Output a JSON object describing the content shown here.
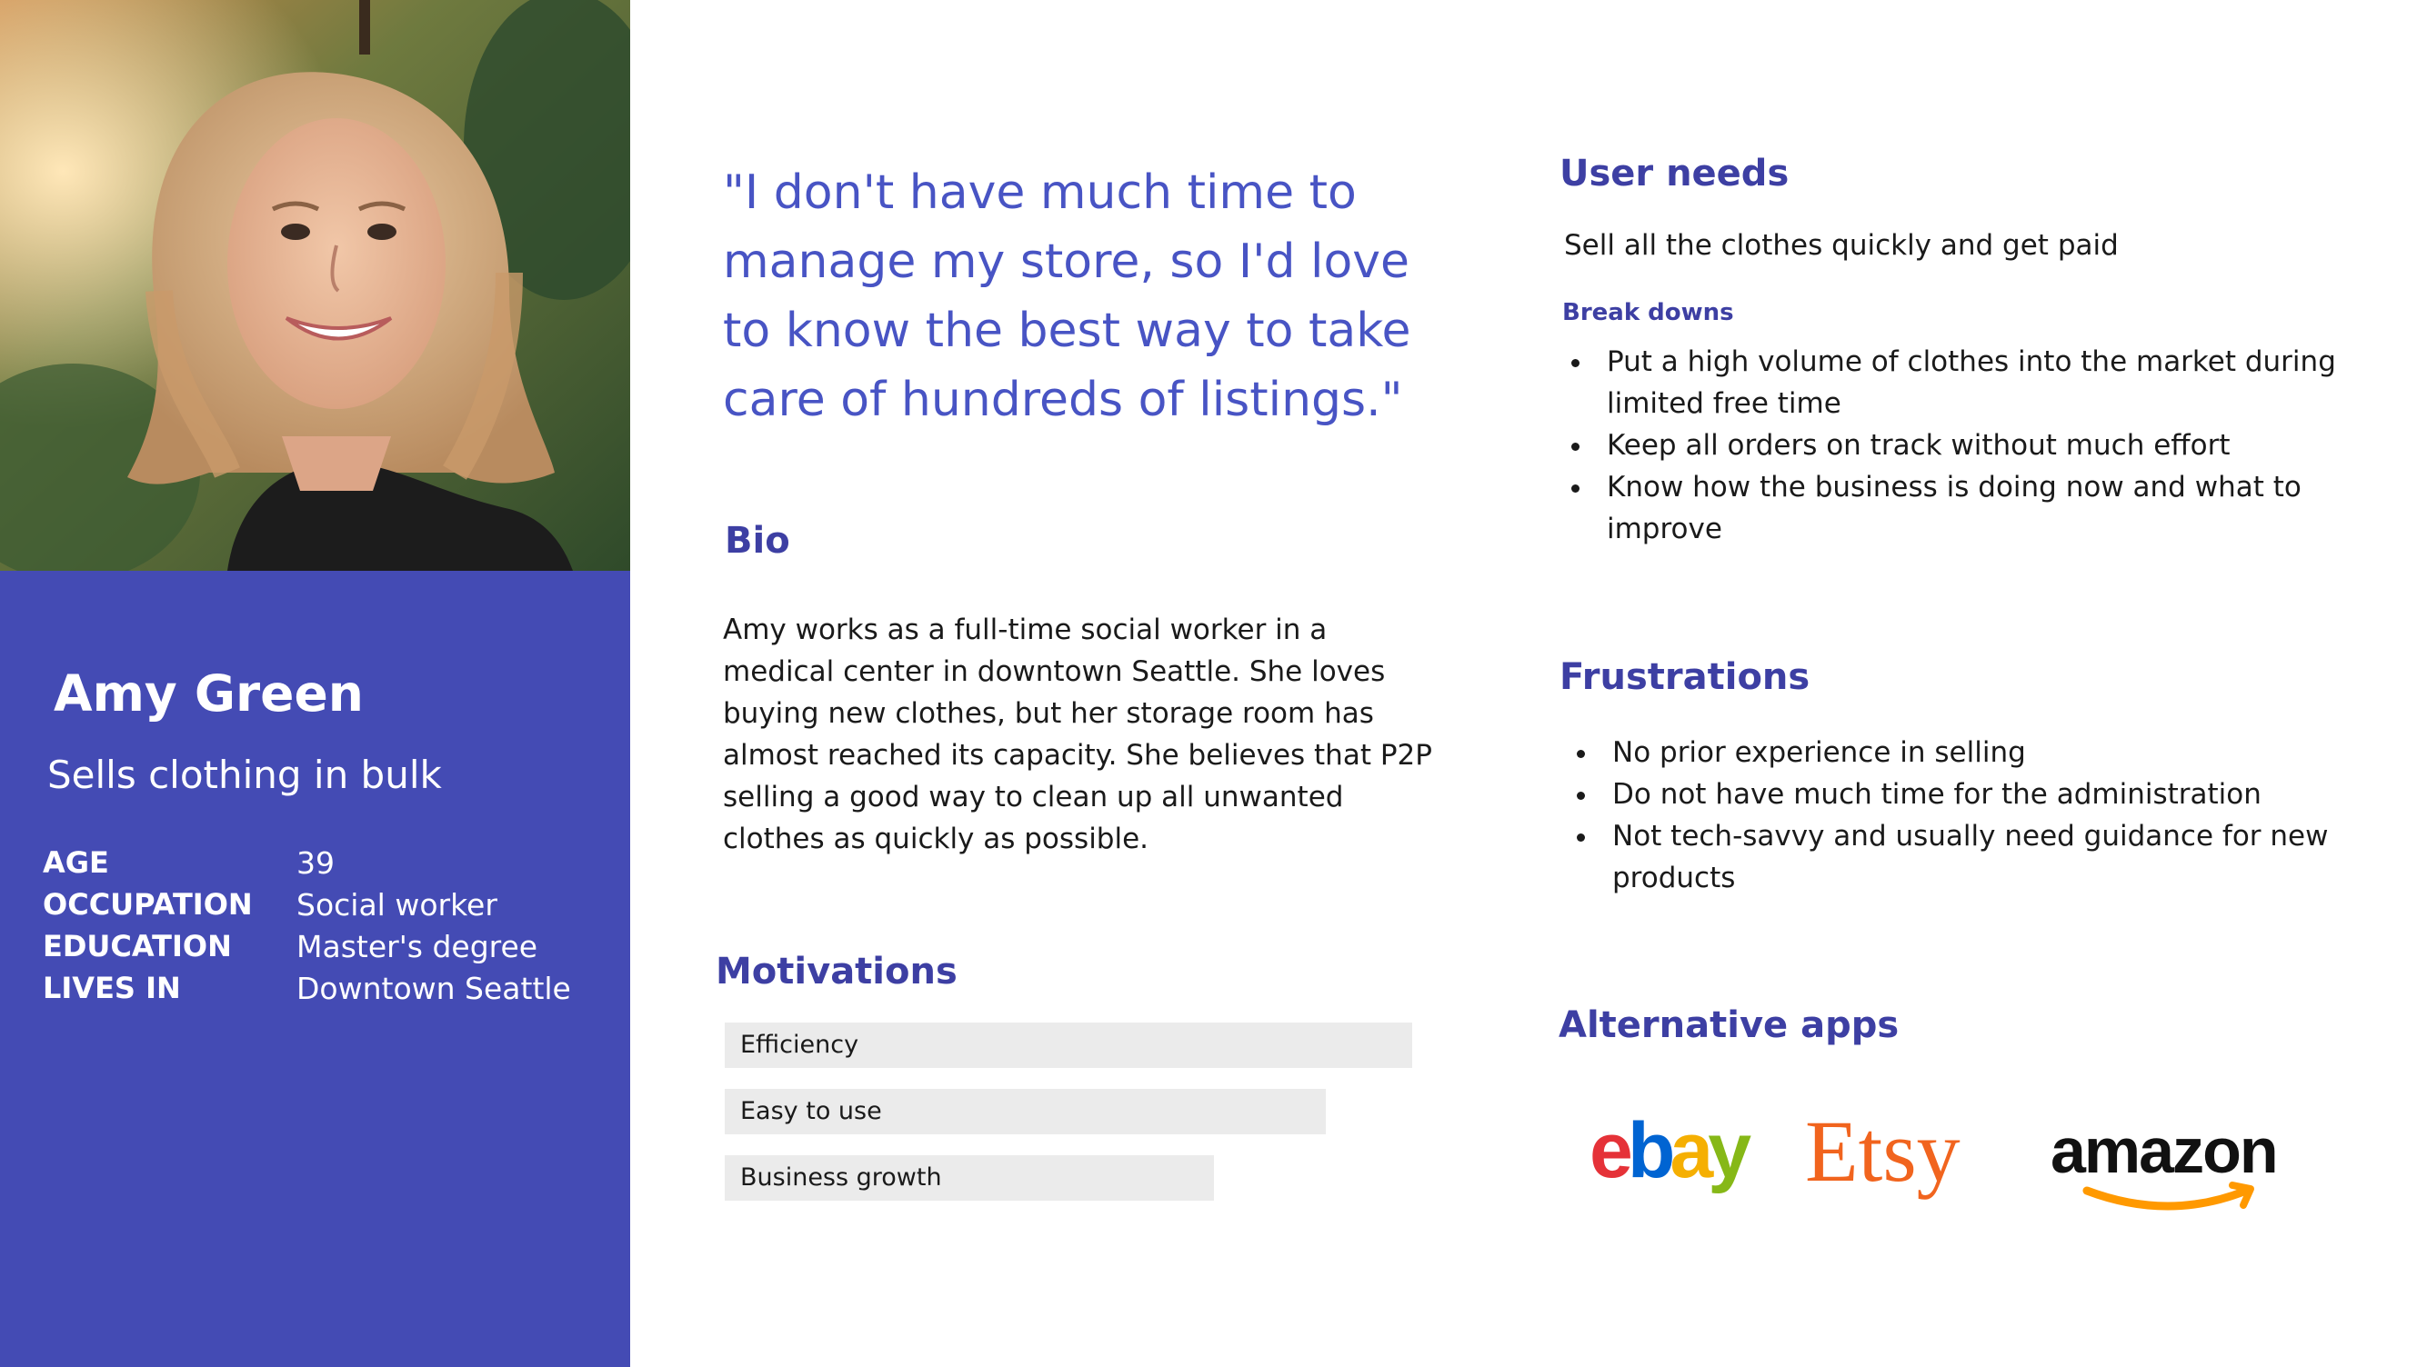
{
  "persona": {
    "name": "Amy Green",
    "tagline": "Sells clothing in bulk",
    "facts": [
      {
        "label": "AGE",
        "value": "39"
      },
      {
        "label": "OCCUPATION",
        "value": "Social worker"
      },
      {
        "label": "EDUCATION",
        "value": "Master's degree"
      },
      {
        "label": "LIVES IN",
        "value": "Downtown Seattle"
      }
    ]
  },
  "quote": "\"I don't have much time to manage my store, so I'd love to know the best way to take care of hundreds of listings.\"",
  "bio": {
    "heading": "Bio",
    "text": "Amy works as a full-time social worker in a medical center in downtown Seattle. She loves buying new clothes, but her storage room has almost reached its capacity. She believes that P2P selling a good way to clean up all unwanted clothes as quickly as possible."
  },
  "motivations": {
    "heading": "Motivations",
    "items": [
      {
        "label": "Efficiency",
        "level": 1.0
      },
      {
        "label": "Easy to use",
        "level": 0.87
      },
      {
        "label": "Business growth",
        "level": 0.71
      }
    ]
  },
  "user_needs": {
    "heading": "User needs",
    "main": "Sell all the clothes quickly and get paid",
    "subheading": "Break downs",
    "items": [
      "Put a high volume of clothes into the market during limited free time",
      "Keep all orders on track without much effort",
      "Know how the business is doing now and what to improve"
    ]
  },
  "frustrations": {
    "heading": "Frustrations",
    "items": [
      "No prior experience in selling",
      "Do not have much time for the administration",
      "Not tech-savvy and usually need guidance for new products"
    ]
  },
  "alternative_apps": {
    "heading": "Alternative apps",
    "logos": [
      {
        "name": "ebay-logo",
        "text": "ebay",
        "colors": [
          "#e53238",
          "#0064d2",
          "#f5af02",
          "#86b817"
        ]
      },
      {
        "name": "etsy-logo",
        "text": "Etsy",
        "colors": [
          "#f1641e"
        ]
      },
      {
        "name": "amazon-logo",
        "text": "amazon",
        "colors": [
          "#111111",
          "#ff9900"
        ]
      }
    ]
  },
  "colors": {
    "sidebar": "#444bb4",
    "quote": "#4854c4",
    "heading": "#3d3fa3",
    "motivation_bar": "#ebebeb"
  }
}
